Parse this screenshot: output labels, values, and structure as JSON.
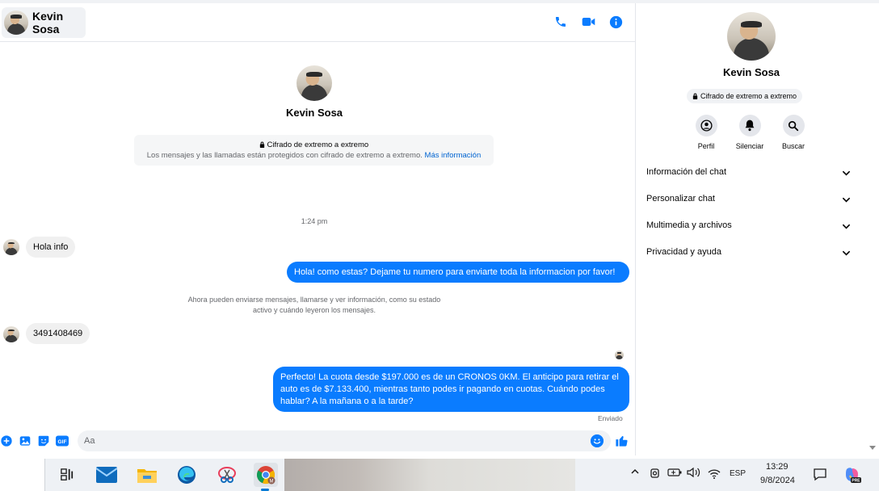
{
  "header": {
    "contact_name": "Kevin Sosa"
  },
  "conversation": {
    "contact_name": "Kevin Sosa",
    "e2ee_title": "Cifrado de extremo a extremo",
    "e2ee_description": "Los mensajes y las llamadas están protegidos con cifrado de extremo a extremo.",
    "e2ee_link": "Más información",
    "timestamp": "1:24 pm",
    "system_note": "Ahora pueden enviarse mensajes, llamarse y ver información, como su estado activo y cuándo leyeron los mensajes.",
    "messages": [
      {
        "direction": "in",
        "text": "Hola info"
      },
      {
        "direction": "out",
        "text": "Hola! como estas? Dejame tu numero para enviarte toda la informacion por favor!"
      },
      {
        "direction": "in",
        "text": "3491408469"
      },
      {
        "direction": "out",
        "text": "Perfecto! La cuota desde $197.000 es de un CRONOS 0KM. El anticipo para retirar el auto es de $7.133.400, mientras tanto podes ir pagando en cuotas. Cuándo podes hablar? A la mañana o a la tarde?"
      }
    ],
    "status": "Enviado"
  },
  "composer": {
    "placeholder": "Aa",
    "gif_label": "GIF"
  },
  "side_panel": {
    "name": "Kevin Sosa",
    "e2ee_label": "Cifrado de extremo a extremo",
    "actions": [
      {
        "label": "Perfil",
        "icon": "profile-icon"
      },
      {
        "label": "Silenciar",
        "icon": "bell-icon"
      },
      {
        "label": "Buscar",
        "icon": "search-icon"
      }
    ],
    "sections": [
      {
        "label": "Información del chat"
      },
      {
        "label": "Personalizar chat"
      },
      {
        "label": "Multimedia y archivos"
      },
      {
        "label": "Privacidad y ayuda"
      }
    ]
  },
  "taskbar": {
    "language": "ESP",
    "time": "13:29",
    "date": "9/8/2024",
    "copilot_badge": "PRE"
  },
  "colors": {
    "accent": "#0a7cff",
    "link": "#0064d1",
    "incoming_bubble": "#f0f0f0"
  }
}
